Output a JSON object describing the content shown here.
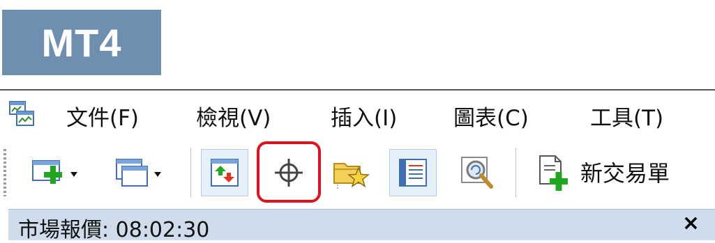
{
  "badge": {
    "text": "MT4",
    "color": "#6f8fb1"
  },
  "menu": {
    "items": [
      {
        "label": "文件(F)"
      },
      {
        "label": "檢視(V)"
      },
      {
        "label": "插入(I)"
      },
      {
        "label": "圖表(C)"
      },
      {
        "label": "工具(T)"
      }
    ]
  },
  "toolbar": {
    "buttons": [
      {
        "icon": "new-chart-icon",
        "has_dropdown": true
      },
      {
        "icon": "profiles-icon",
        "has_dropdown": true
      },
      {
        "icon": "market-watch-icon",
        "active": true
      },
      {
        "icon": "crosshair-icon",
        "highlighted": true
      },
      {
        "icon": "navigator-icon"
      },
      {
        "icon": "terminal-icon",
        "active": true
      },
      {
        "icon": "strategy-tester-icon"
      },
      {
        "icon": "new-order-icon"
      }
    ],
    "new_order_label": "新交易單",
    "highlight_color": "#e0101c"
  },
  "market_watch": {
    "title": "市場報價: 08:02:30",
    "close_label": "×"
  }
}
